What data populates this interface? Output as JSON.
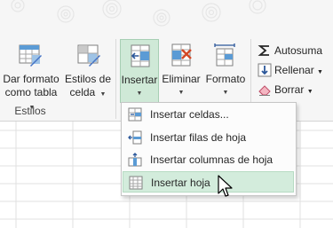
{
  "ribbon": {
    "buttons": {
      "dar_formato": {
        "line1": "Dar formato",
        "line2": "como tabla",
        "icon": "table-format-icon"
      },
      "estilos_celda": {
        "line1": "Estilos de",
        "line2": "celda",
        "icon": "cell-styles-icon"
      },
      "insertar": {
        "label": "Insertar",
        "icon": "insert-cells-icon"
      },
      "eliminar": {
        "label": "Eliminar",
        "icon": "delete-cells-icon"
      },
      "formato": {
        "label": "Formato",
        "icon": "format-cells-icon"
      }
    },
    "group_label": "Estilos",
    "editing": {
      "autosuma": "Autosuma",
      "rellenar": "Rellenar",
      "borrar": "Borrar"
    }
  },
  "insert_menu": {
    "items": [
      {
        "label": "Insertar celdas...",
        "icon": "insert-cells-icon",
        "highlighted": false
      },
      {
        "label": "Insertar filas de hoja",
        "icon": "insert-rows-icon",
        "highlighted": false
      },
      {
        "label": "Insertar columnas de hoja",
        "icon": "insert-columns-icon",
        "highlighted": false
      },
      {
        "label": "Insertar hoja",
        "icon": "insert-sheet-icon",
        "highlighted": true
      }
    ]
  },
  "colors": {
    "active_green": "#cfe9d7",
    "highlight_green": "#d3ecdc",
    "ribbon_bg": "#f6f6f6",
    "delete_red": "#d24726",
    "accent_blue": "#2b579a"
  }
}
